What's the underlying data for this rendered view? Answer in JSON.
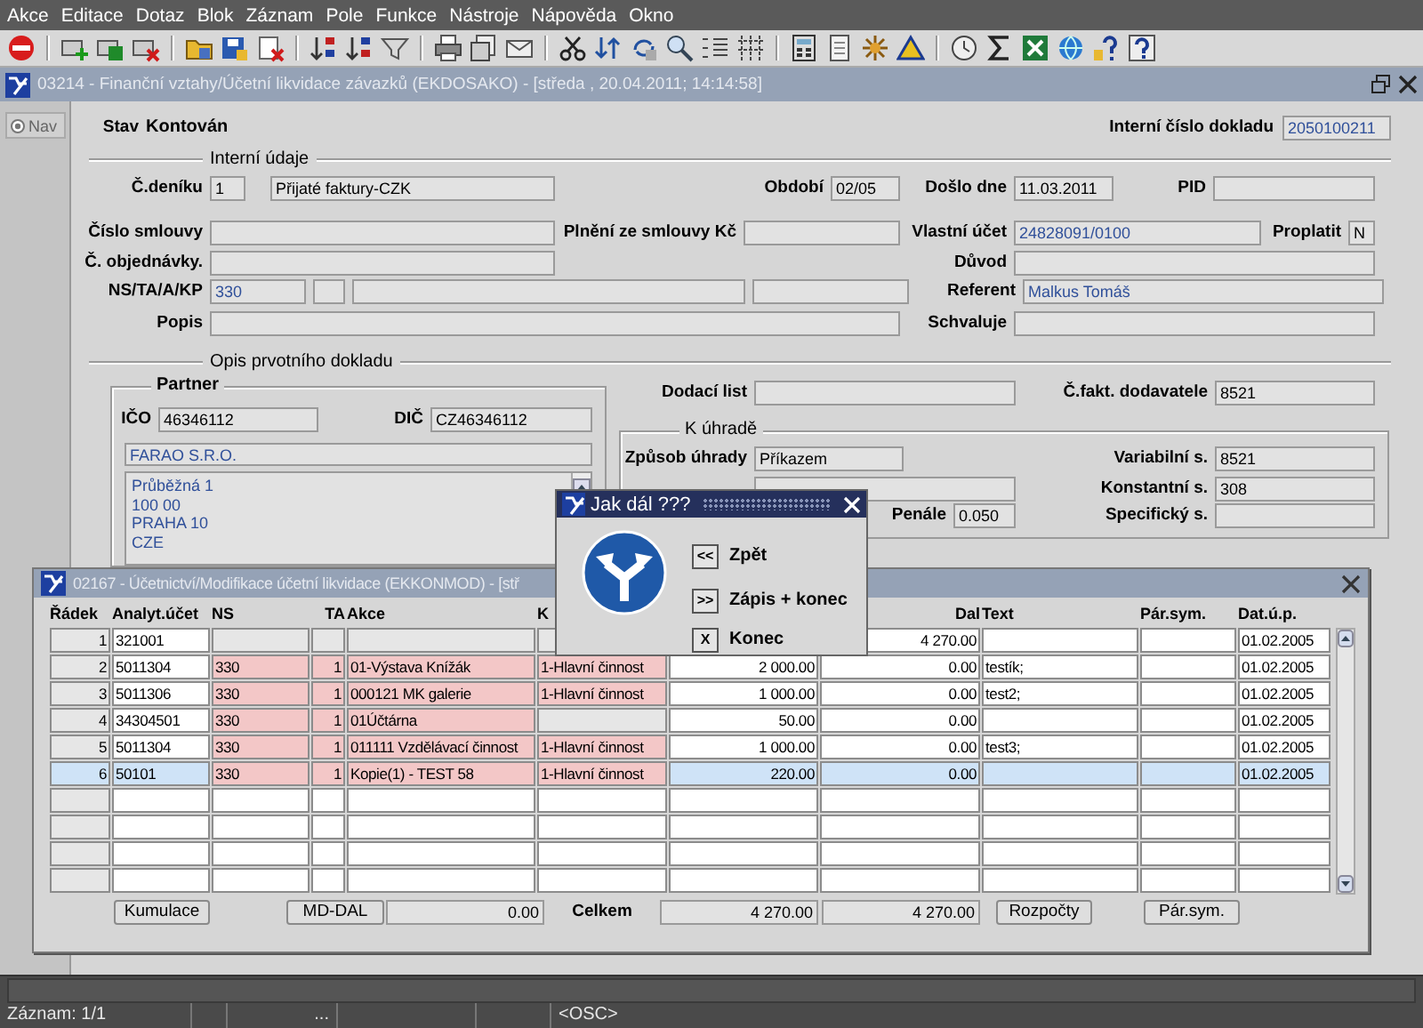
{
  "menu": [
    "Akce",
    "Editace",
    "Dotaz",
    "Blok",
    "Záznam",
    "Pole",
    "Funkce",
    "Nástroje",
    "Nápověda",
    "Okno"
  ],
  "main_window": {
    "title": "03214 - Finanční vztahy/Účetní likvidace závazků (EKDOSAKO) - [středa , 20.04.2011; 14:14:58]",
    "nav_button": "Nav",
    "stav": {
      "label": "Stav",
      "value": "Kontován"
    },
    "document_number": {
      "label": "Interní číslo dokladu",
      "value": "2050100211",
      "readonly": true
    },
    "interni_udaje": {
      "title": "Interní údaje",
      "fields": [
        {
          "label": "Č.deníku",
          "value": "1",
          "readonly": false
        },
        {
          "value": "Přijaté faktury-CZK",
          "readonly": false
        },
        {
          "label": "Období",
          "value": "02/05",
          "readonly": false
        },
        {
          "label": "Došlo dne",
          "value": "11.03.2011",
          "readonly": false
        },
        {
          "label": "PID"
        },
        {
          "label": "Číslo smlouvy"
        },
        {
          "label": "Plnění ze smlouvy Kč"
        },
        {
          "label": "Vlastní účet",
          "value": "24828091/0100",
          "readonly": true
        },
        {
          "label": "Proplatit",
          "value": "N",
          "readonly": false
        },
        {
          "label": "Č. objednávky."
        },
        {
          "label": "Důvod"
        },
        {
          "label": "NS/TA/A/KP",
          "value": "330",
          "readonly": true
        },
        {
          "kind": "text-field"
        },
        {
          "kind": "text-field"
        },
        {
          "kind": "text-field"
        },
        {
          "label": "Referent",
          "value": "Malkus Tomáš",
          "readonly": true
        },
        {
          "label": "Popis"
        },
        {
          "label": "Schvaluje"
        }
      ]
    },
    "opis": {
      "title": "Opis prvotního dokladu",
      "partner": {
        "title": "Partner",
        "fields": [
          {
            "label": "IČO",
            "value": "46346112",
            "readonly": false
          },
          {
            "label": "DIČ",
            "value": "CZ46346112",
            "readonly": false
          }
        ],
        "name": {
          "value": "FARAO S.R.O.",
          "readonly": true
        },
        "address": {
          "lines": [
            "Průběžná 1",
            "100 00",
            "PRAHA 10",
            "CZE"
          ],
          "readonly": true
        }
      },
      "fields": [
        {
          "label": "Dodací list"
        },
        {
          "label": "Č.fakt. dodavatele",
          "value": "8521",
          "readonly": false
        }
      ],
      "k_uhrade": {
        "title": "K úhradě",
        "fields": [
          {
            "label": "Způsob úhrady",
            "value": "Příkazem",
            "readonly": false
          },
          {
            "label": "Variabilní s.",
            "value": "8521",
            "readonly": false
          },
          {
            "kind": "text-field"
          },
          {
            "label": "Konstantní s.",
            "value": "308",
            "readonly": false
          },
          {
            "label": "Penále",
            "value": "0.050",
            "readonly": false
          },
          {
            "label": "Specifický s."
          }
        ]
      }
    }
  },
  "table_window": {
    "title": "02167 - Účetnictví/Modifikace účetní likvidace (EKKONMOD) - [stř",
    "columns": [
      {
        "label": "Řádek",
        "kind": "rownum"
      },
      {
        "label": "Analyt.účet",
        "kind": "text"
      },
      {
        "label": "NS",
        "kind": "code"
      },
      {
        "label": "TA",
        "kind": "code-number"
      },
      {
        "label": "Akce",
        "kind": "code"
      },
      {
        "label": "K",
        "kind": "code"
      },
      {
        "kind": "number"
      },
      {
        "label": "Dal",
        "kind": "number"
      },
      {
        "label": "Text",
        "kind": "text"
      },
      {
        "label": "Pár.sym.",
        "kind": "text"
      },
      {
        "label": "Dat.ú.p.",
        "kind": "text"
      }
    ],
    "rows": [
      {
        "selected": false,
        "cells": [
          "1",
          "321001",
          null,
          null,
          null,
          null,
          null,
          "4 270.00",
          null,
          null,
          "01.02.2005"
        ]
      },
      {
        "selected": false,
        "cells": [
          "2",
          "5011304",
          "330",
          "1",
          "01-Výstava Knížák",
          "1-Hlavní činnost",
          "2 000.00",
          "0.00",
          "testík;",
          null,
          "01.02.2005"
        ]
      },
      {
        "selected": false,
        "cells": [
          "3",
          "5011306",
          "330",
          "1",
          "000121 MK galerie",
          "1-Hlavní činnost",
          "1 000.00",
          "0.00",
          "test2;",
          null,
          "01.02.2005"
        ]
      },
      {
        "selected": false,
        "cells": [
          "4",
          "34304501",
          "330",
          "1",
          "01Účtárna",
          null,
          "50.00",
          "0.00",
          null,
          null,
          "01.02.2005"
        ]
      },
      {
        "selected": false,
        "cells": [
          "5",
          "5011304",
          "330",
          "1",
          "011111 Vzdělávací činnost",
          "1-Hlavní činnost",
          "1 000.00",
          "0.00",
          "test3;",
          null,
          "01.02.2005"
        ]
      },
      {
        "selected": true,
        "cells": [
          "6",
          "50101",
          "330",
          "1",
          "Kopie(1) - TEST 58",
          "1-Hlavní činnost",
          "220.00",
          "0.00",
          null,
          null,
          "01.02.2005"
        ]
      }
    ],
    "footer": {
      "kumulace": "Kumulace",
      "md_dal": "MD-DAL",
      "md_dal_value": "0.00",
      "total_label": "Celkem",
      "total_md": "4 270.00",
      "total_dal": "4 270.00",
      "rozpocty": "Rozpočty",
      "par_sym": "Pár.sym."
    }
  },
  "dialog": {
    "title": "Jak dál ???",
    "options": [
      {
        "key": "<<",
        "label": "Zpět"
      },
      {
        "key": ">>",
        "label": "Zápis + konec"
      },
      {
        "key": "X",
        "label": "Konec"
      }
    ]
  },
  "status_bar": {
    "record": "Záznam: 1/1",
    "ellipsis": "...",
    "mode": "<OSC>"
  }
}
